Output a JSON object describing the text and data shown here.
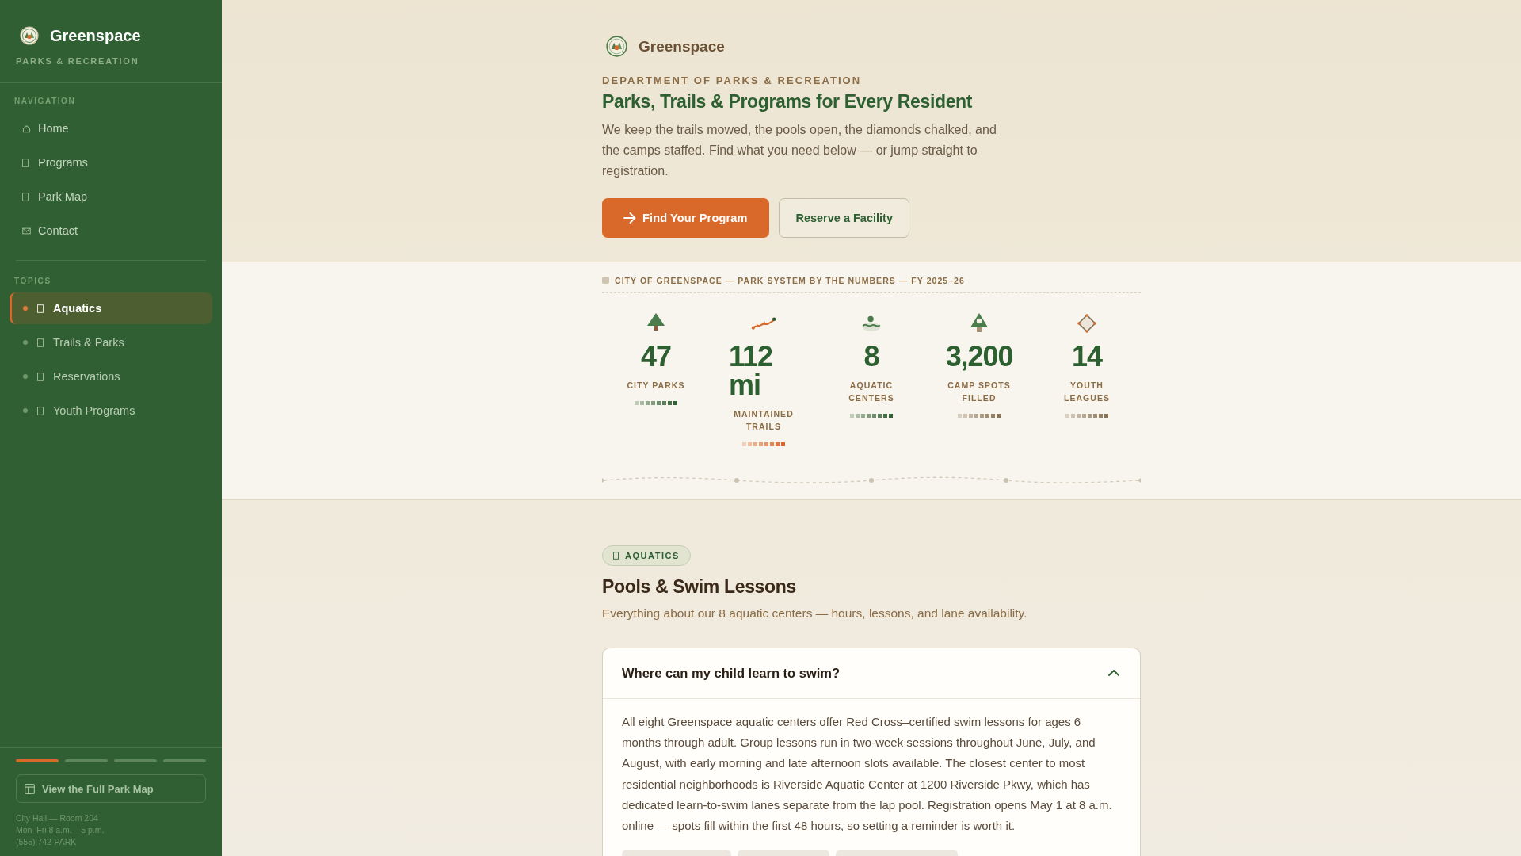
{
  "sidebar": {
    "brand": "Greenspace",
    "tagline": "PARKS & RECREATION",
    "nav_heading": "NAVIGATION",
    "nav": [
      {
        "label": "Home"
      },
      {
        "label": "Programs"
      },
      {
        "label": "Park Map"
      },
      {
        "label": "Contact"
      }
    ],
    "topics_heading": "TOPICS",
    "topics": [
      {
        "label": "Aquatics",
        "selected": true
      },
      {
        "label": "Trails & Parks",
        "selected": false
      },
      {
        "label": "Reservations",
        "selected": false
      },
      {
        "label": "Youth Programs",
        "selected": false
      }
    ],
    "progress_segments": [
      {
        "selected": true
      },
      {
        "selected": false
      },
      {
        "selected": false
      },
      {
        "selected": false
      }
    ],
    "map_button": "View the Full Park Map",
    "contact_lines": [
      "City Hall — Room 204",
      "Mon–Fri 8 a.m. – 5 p.m.",
      "(555) 742-PARK"
    ]
  },
  "hero": {
    "brand": "Greenspace",
    "eyebrow": "DEPARTMENT OF PARKS & RECREATION",
    "title": "Parks, Trails & Programs for Every Resident",
    "intro": "We keep the trails mowed, the pools open, the diamonds chalked, and the camps staffed. Find what you need below — or jump straight to registration.",
    "buttons": [
      {
        "label": "Find Your Program",
        "kind": "primary"
      },
      {
        "label": "Reserve a Facility",
        "kind": "secondary"
      }
    ]
  },
  "stats": {
    "caption": "CITY OF GREENSPACE — PARK SYSTEM BY THE NUMBERS — FY 2025–26",
    "items": [
      {
        "value": "47",
        "label": "CITY PARKS",
        "color": "#2f6133"
      },
      {
        "value": "112 mi",
        "label": "MAINTAINED TRAILS",
        "color": "#d9692b"
      },
      {
        "value": "8",
        "label": "AQUATIC CENTERS",
        "color": "#2f6133"
      },
      {
        "value": "3,200",
        "label": "CAMP SPOTS FILLED",
        "color": "#8a7253"
      },
      {
        "value": "14",
        "label": "YOUTH LEAGUES",
        "color": "#8a7253"
      }
    ]
  },
  "section": {
    "badge": "AQUATICS",
    "title": "Pools & Swim Lessons",
    "subtitle": "Everything about our 8 aquatic centers — hours, lessons, and lane availability.",
    "faq": [
      {
        "question": "Where can my child learn to swim?",
        "expanded": true,
        "answer": "All eight Greenspace aquatic centers offer Red Cross–certified swim lessons for ages 6 months through adult. Group lessons run in two-week sessions throughout June, July, and August, with early morning and late afternoon slots available. The closest center to most residential neighborhoods is Riverside Aquatic Center at 1200 Riverside Pkwy, which has dedicated learn-to-swim lanes separate from the lap pool. Registration opens May 1 at 8 a.m. online — spots fill within the first 48 hours, so setting a reminder is worth it."
      }
    ]
  }
}
